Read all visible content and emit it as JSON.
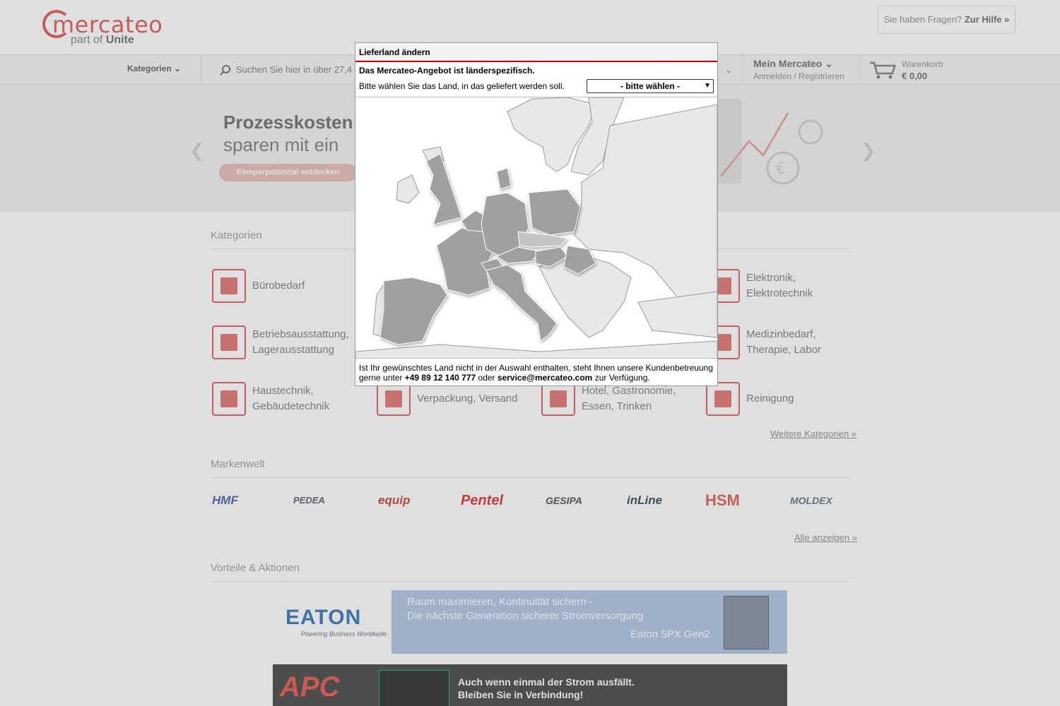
{
  "header": {
    "logo": "mercateo",
    "logo_sub_prefix": "part of",
    "logo_sub_brand": "Unite",
    "help_question": "Sie haben Fragen?",
    "help_link": "Zur Hilfe »"
  },
  "navbar": {
    "categories_label": "Kategorien",
    "search_placeholder": "Suchen Sie hier in über 27,4",
    "account_title": "Mein Mercateo",
    "account_sub": "Anmelden / Registrieren",
    "cart_label": "Warenkorb",
    "cart_value": "€ 0,00"
  },
  "banner": {
    "line1": "Prozesskosten",
    "line2": "sparen mit ein",
    "button": "Einsparpotenzial entdecken"
  },
  "categories": {
    "title": "Kategorien",
    "items": [
      {
        "label": "Bürobedarf"
      },
      {
        "label": "Elektronik, Elektrotechnik"
      },
      {
        "label": "Betriebsausstattung, Lagerausstattung"
      },
      {
        "label": "Medizinbedarf, Therapie, Labor"
      },
      {
        "label": "Haustechnik, Gebäudetechnik"
      },
      {
        "label": "Verpackung, Versand"
      },
      {
        "label": "Hotel, Gastronomie, Essen, Trinken"
      },
      {
        "label": "Reinigung"
      }
    ],
    "more": "Weitere Kategorien »"
  },
  "brands": {
    "title": "Markenwelt",
    "items": [
      "HMF",
      "PEDEA",
      "equip",
      "Pentel",
      "GESIPA",
      "inLine",
      "HSM",
      "MOLDEX"
    ],
    "more": "Alle anzeigen »"
  },
  "promos": {
    "title": "Vorteile & Aktionen",
    "eaton_logo": "EATON",
    "eaton_sub": "Powering Business Worldwide",
    "eaton_line1": "Raum maximieren, Kontinuität sichern -",
    "eaton_line2": "Die nächste Generation sicherer Stromversorgung",
    "eaton_line3": "Eaton 5PX Gen2",
    "apc_logo": "APC",
    "apc_line1": "Auch wenn einmal der Strom ausfällt.",
    "apc_line2": "Bleiben Sie in Verbindung!"
  },
  "modal": {
    "title": "Lieferland ändern",
    "headline": "Das Mercateo-Angebot ist länderspezifisch.",
    "prompt": "Bitte wählen Sie das Land, in das geliefert werden soll.",
    "select_value": "- bitte wählen -",
    "foot_text1": "Ist Ihr gewünschtes Land nicht in der Auswahl enthalten, steht Ihnen unsere Kundenbetreuung gerne unter",
    "phone": "+49 89 12 140 777",
    "foot_or": "oder",
    "email": "service@mercateo.com",
    "foot_text2": "zur Verfügung."
  },
  "colors": {
    "brand_red": "#d9534f",
    "modal_accent": "#cc0000",
    "map_highlight": "#a0a0a0",
    "map_base": "#e8e8e8"
  }
}
